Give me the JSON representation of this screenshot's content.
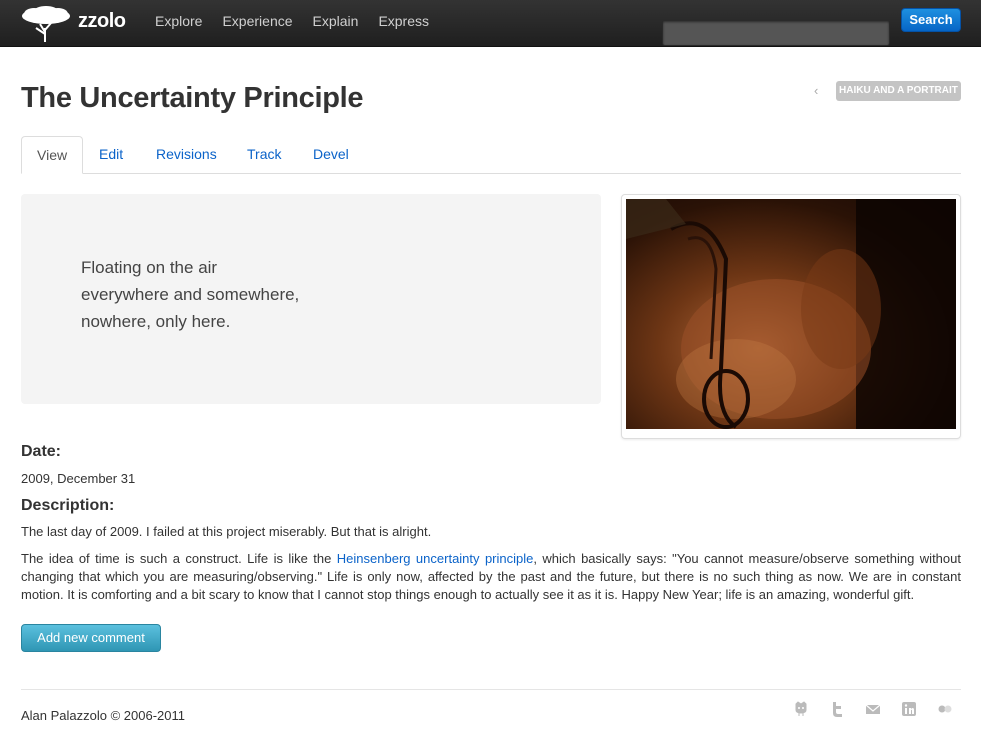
{
  "header": {
    "logo_text": "zzolo",
    "nav": [
      "Explore",
      "Experience",
      "Explain",
      "Express"
    ],
    "search_placeholder": "",
    "search_button": "Search"
  },
  "page": {
    "title": "The Uncertainty Principle",
    "prev_arrow": "‹",
    "prev_label": "Haiku and a Portrait"
  },
  "tabs": [
    "View",
    "Edit",
    "Revisions",
    "Track",
    "Devel"
  ],
  "haiku": {
    "lines": [
      "Floating on the air",
      "everywhere and somewhere,",
      "nowhere, only here."
    ]
  },
  "fields": {
    "date_label": "Date:",
    "date_value": "2009, December 31",
    "description_label": "Description:",
    "para1": "The last day of 2009. I failed at this project miserably. But that is alright.",
    "para2_before": "The idea of time is such a construct. Life is like the ",
    "para2_link": "Heinsenberg uncertainty principle",
    "para2_after": ", which basically says: \"You cannot measure/observe something without changing that which you are measuring/observing.\" Life is only now, affected by the past and the future, but there is no such thing as now. We are in constant motion. It is comforting and a bit scary to know that I cannot stop things enough to actually see it as it is. Happy New Year; life is an amazing, wonderful gift."
  },
  "actions": {
    "add_comment": "Add new comment"
  },
  "footer": {
    "copyright": "Alan Palazzolo © 2006-2011",
    "social_icons": [
      "github-icon",
      "twitter-icon",
      "email-icon",
      "linkedin-icon",
      "flickr-icon"
    ]
  },
  "colors": {
    "navbar": "#1f1f1f",
    "link": "#0b63c9",
    "search_button": "#0665c6",
    "comment_button": "#2f96b4",
    "badge": "#c4c4c4"
  }
}
